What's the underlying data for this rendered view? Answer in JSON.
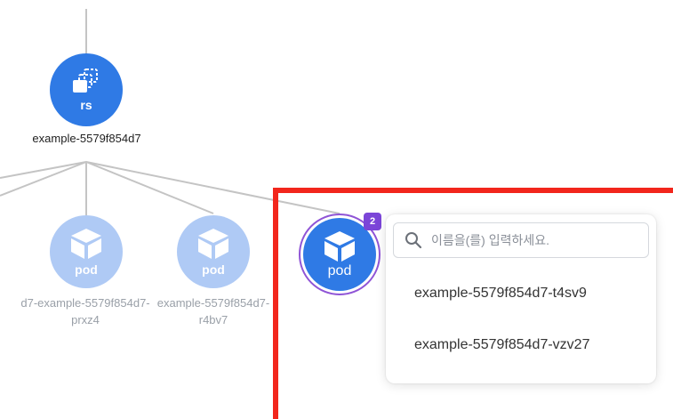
{
  "topology": {
    "replicaset": {
      "kind": "rs",
      "name": "example-5579f854d7",
      "icon": "replicaset-icon"
    },
    "pods_faded": [
      {
        "kind": "pod",
        "label_line1": "d7-example-5579f854d7-",
        "label_line2": "prxz4",
        "icon": "cube-icon"
      },
      {
        "kind": "pod",
        "label_line1": "example-5579f854d7-",
        "label_line2": "r4bv7",
        "icon": "cube-icon"
      }
    ],
    "pod_group": {
      "kind": "pod",
      "count": "2",
      "icon": "cube-icon"
    }
  },
  "popover": {
    "search_placeholder": "이름을(를) 입력하세요.",
    "items": [
      "example-5579f854d7-t4sv9",
      "example-5579f854d7-vzv27"
    ]
  },
  "colors": {
    "node_blue": "#2f7ae5",
    "node_faded": "#afcaf5",
    "badge_purple": "#7b45d8",
    "highlight_red": "#f2261c"
  }
}
